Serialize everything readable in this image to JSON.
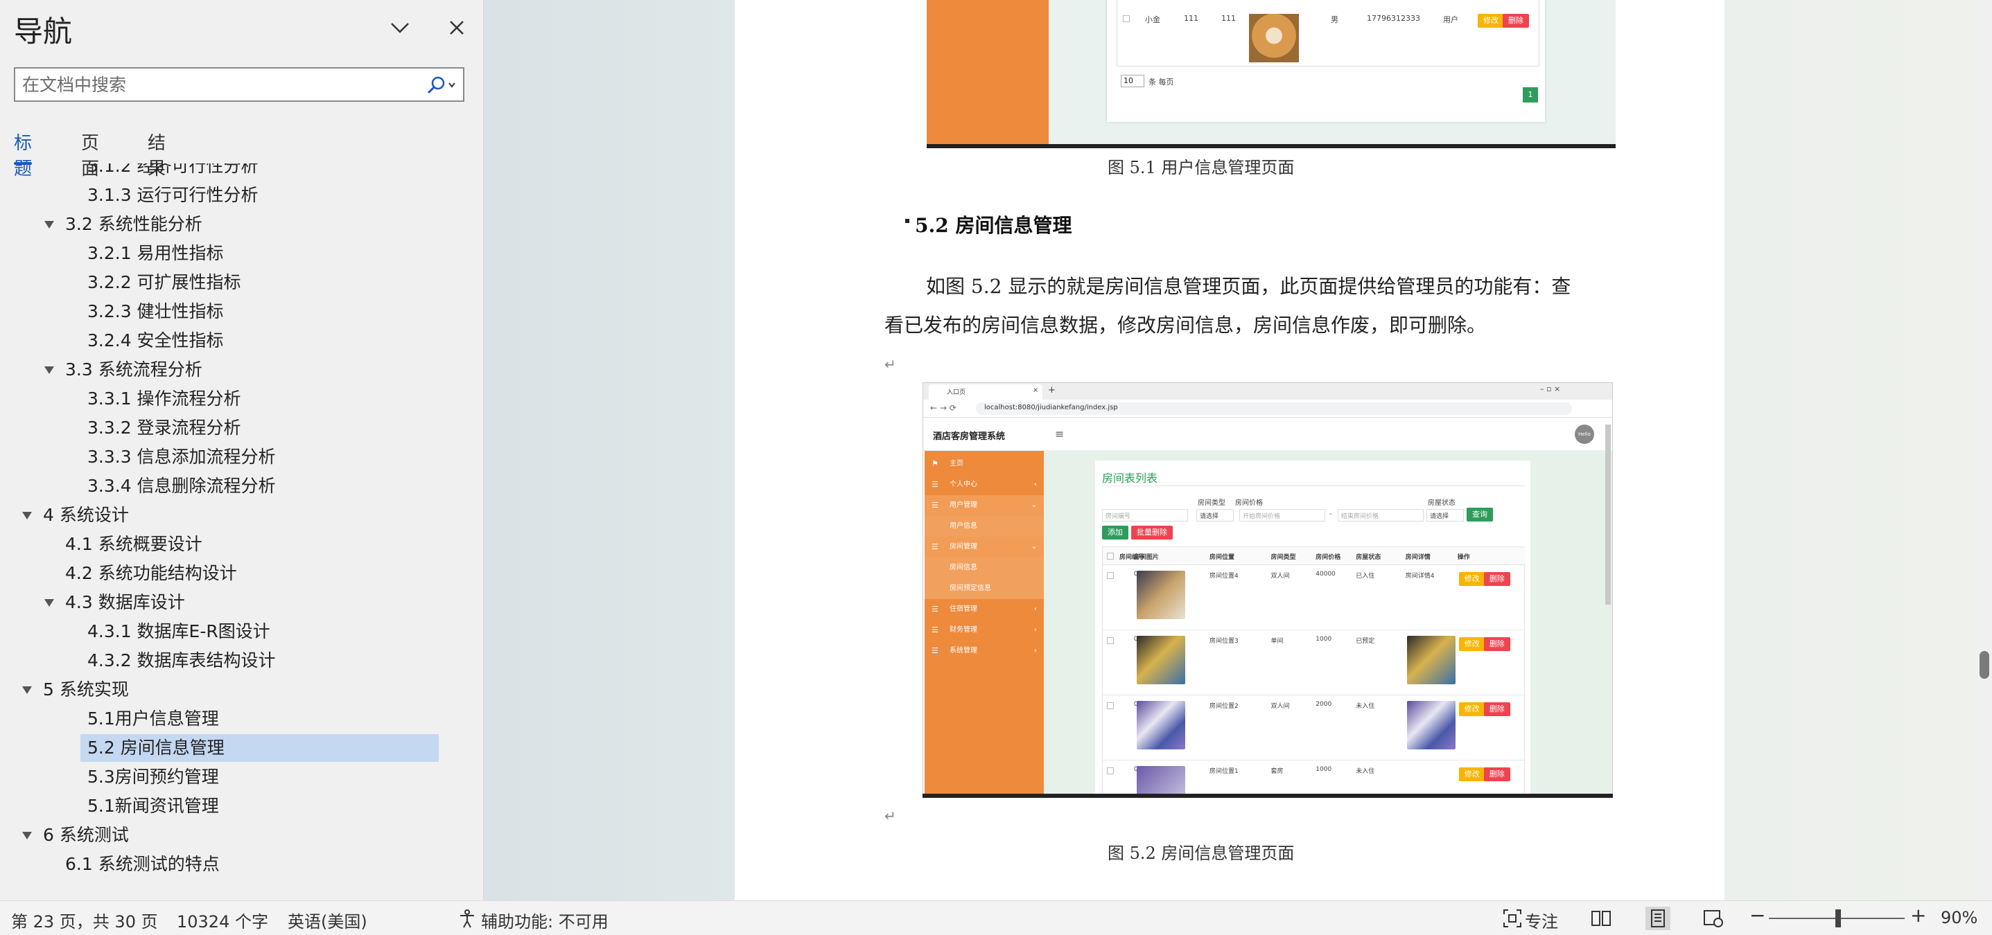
{
  "nav": {
    "title": "导航",
    "search_placeholder": "在文档中搜索",
    "tabs": [
      "标题",
      "页面",
      "结果"
    ],
    "items": [
      {
        "label": "3.1.2 经济可行性分析",
        "level": 3,
        "expandable": false,
        "selected": false
      },
      {
        "label": "3.1.3 运行可行性分析",
        "level": 3,
        "expandable": false,
        "selected": false
      },
      {
        "label": "3.2 系统性能分析",
        "level": 2,
        "expandable": true,
        "selected": false
      },
      {
        "label": "3.2.1 易用性指标",
        "level": 3,
        "expandable": false,
        "selected": false
      },
      {
        "label": "3.2.2 可扩展性指标",
        "level": 3,
        "expandable": false,
        "selected": false
      },
      {
        "label": "3.2.3 健壮性指标",
        "level": 3,
        "expandable": false,
        "selected": false
      },
      {
        "label": "3.2.4 安全性指标",
        "level": 3,
        "expandable": false,
        "selected": false
      },
      {
        "label": "3.3 系统流程分析",
        "level": 2,
        "expandable": true,
        "selected": false
      },
      {
        "label": "3.3.1 操作流程分析",
        "level": 3,
        "expandable": false,
        "selected": false
      },
      {
        "label": "3.3.2 登录流程分析",
        "level": 3,
        "expandable": false,
        "selected": false
      },
      {
        "label": "3.3.3 信息添加流程分析",
        "level": 3,
        "expandable": false,
        "selected": false
      },
      {
        "label": "3.3.4 信息删除流程分析",
        "level": 3,
        "expandable": false,
        "selected": false
      },
      {
        "label": "4 系统设计",
        "level": 1,
        "expandable": true,
        "selected": false
      },
      {
        "label": "4.1 系统概要设计",
        "level": 2,
        "expandable": false,
        "selected": false
      },
      {
        "label": "4.2 系统功能结构设计",
        "level": 2,
        "expandable": false,
        "selected": false
      },
      {
        "label": "4.3 数据库设计",
        "level": 2,
        "expandable": true,
        "selected": false
      },
      {
        "label": "4.3.1 数据库E-R图设计",
        "level": 3,
        "expandable": false,
        "selected": false
      },
      {
        "label": "4.3.2 数据库表结构设计",
        "level": 3,
        "expandable": false,
        "selected": false
      },
      {
        "label": "5 系统实现",
        "level": 1,
        "expandable": true,
        "selected": false
      },
      {
        "label": "5.1用户信息管理",
        "level": 3,
        "expandable": false,
        "selected": false
      },
      {
        "label": "5.2 房间信息管理",
        "level": 3,
        "expandable": false,
        "selected": true
      },
      {
        "label": "5.3房间预约管理",
        "level": 3,
        "expandable": false,
        "selected": false
      },
      {
        "label": "5.1新闻资讯管理",
        "level": 3,
        "expandable": false,
        "selected": false
      },
      {
        "label": "6 系统测试",
        "level": 1,
        "expandable": true,
        "selected": false
      },
      {
        "label": "6.1  系统测试的特点",
        "level": 2,
        "expandable": false,
        "selected": false
      }
    ]
  },
  "doc": {
    "fig1_caption": "图 5.1  用户信息管理页面",
    "section_heading": "5.2  房间信息管理",
    "para_line1": "如图 5.2 显示的就是房间信息管理页面，此页面提供给管理员的功能有：查",
    "para_line2": "看已发布的房间信息数据，修改房间信息，房间信息作废，即可删除。",
    "fig2_caption": "图 5.2  房间信息管理页面",
    "pilcrow": "↵"
  },
  "shot1": {
    "row": [
      "小金",
      "111",
      "111",
      "男",
      "17796312333",
      "用户"
    ],
    "edit": "修改",
    "del": "删除",
    "page_size": "10",
    "per_page": "条 每页",
    "page_num": "1"
  },
  "shot2": {
    "tab_title": "入口页",
    "url": "localhost:8080/jiudiankefang/index.jsp",
    "app_title": "酒店客房管理系统",
    "menu": [
      "主页",
      "个人中心",
      "用户管理",
      "用户信息",
      "房间管理",
      "房间信息",
      "房间预定信息",
      "住宿管理",
      "财务管理",
      "系统管理"
    ],
    "list_title": "房间表列表",
    "f_type": "房间类型",
    "f_price": "房间价格",
    "f_status": "房屋状态",
    "f_no_ph": "房间编号",
    "f_select": "请选择",
    "f_min_ph": "开始房间价格",
    "f_max_ph": "结束房间价格",
    "f_dash": "-",
    "btn_query": "查询",
    "btn_add": "添加",
    "btn_batch_del": "批量删除",
    "cols": [
      "房间编号",
      "房间图片",
      "房间位置",
      "房间类型",
      "房间价格",
      "房屋状态",
      "房间详情",
      "操作"
    ],
    "rows": [
      {
        "no": "004",
        "pos": "房间位置4",
        "type": "双人间",
        "price": "40000",
        "status": "已入住",
        "detail": "房间详情4"
      },
      {
        "no": "003",
        "pos": "房间位置3",
        "type": "单间",
        "price": "1000",
        "status": "已预定",
        "detail": ""
      },
      {
        "no": "002",
        "pos": "房间位置2",
        "type": "双人间",
        "price": "2000",
        "status": "未入住",
        "detail": ""
      },
      {
        "no": "001",
        "pos": "房间位置1",
        "type": "套房",
        "price": "1000",
        "status": "未入住",
        "detail": ""
      }
    ],
    "edit": "修改",
    "del": "删除",
    "avatar_text": "Hello"
  },
  "status": {
    "page": "第 23 页，共 30 页",
    "words": "10324 个字",
    "lang": "英语(美国)",
    "access": "辅助功能: 不可用",
    "focus": "专注",
    "zoom": "90%",
    "zoom_fraction": 0.51
  },
  "colors": {
    "accent": "#185abd",
    "orange": "#ee8a3c",
    "green": "#2e9c5b",
    "danger": "#f0424f",
    "warn": "#f7b500"
  }
}
